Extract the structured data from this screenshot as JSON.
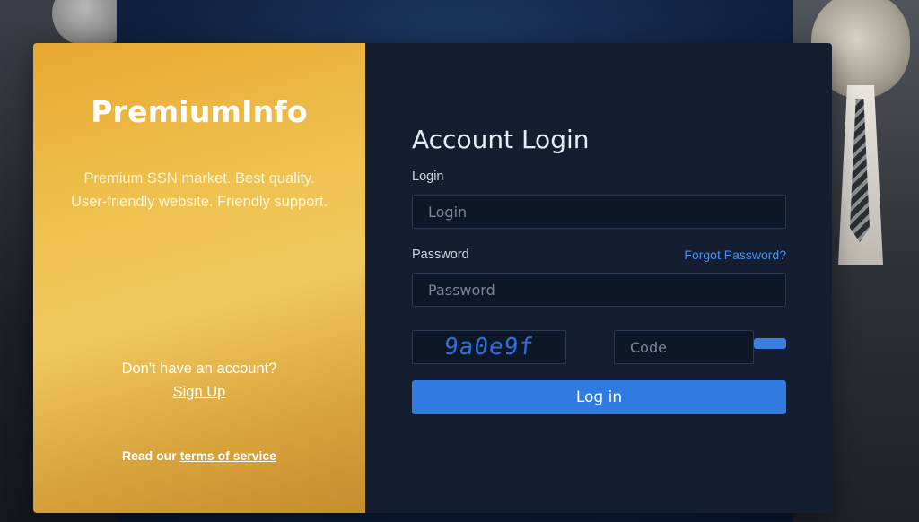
{
  "promo": {
    "brand": "PremiumInfo",
    "tagline": "Premium SSN market. Best quality. User-friendly website. Friendly support.",
    "signup_question": "Don't have an account?",
    "signup_link": "Sign Up",
    "terms_prefix": "Read our",
    "terms_link": "terms of service"
  },
  "form": {
    "title": "Account Login",
    "login_label": "Login",
    "login_placeholder": "Login",
    "login_value": "",
    "password_label": "Password",
    "password_placeholder": "Password",
    "password_value": "",
    "forgot_link": "Forgot Password?",
    "captcha_text": "9a0e9f",
    "code_placeholder": "Code",
    "code_value": "",
    "submit_label": "Log in"
  },
  "colors": {
    "promo_gradient": "#efc250",
    "panel_bg": "#141e30",
    "accent": "#2f7be0",
    "link": "#4a8ff0"
  }
}
